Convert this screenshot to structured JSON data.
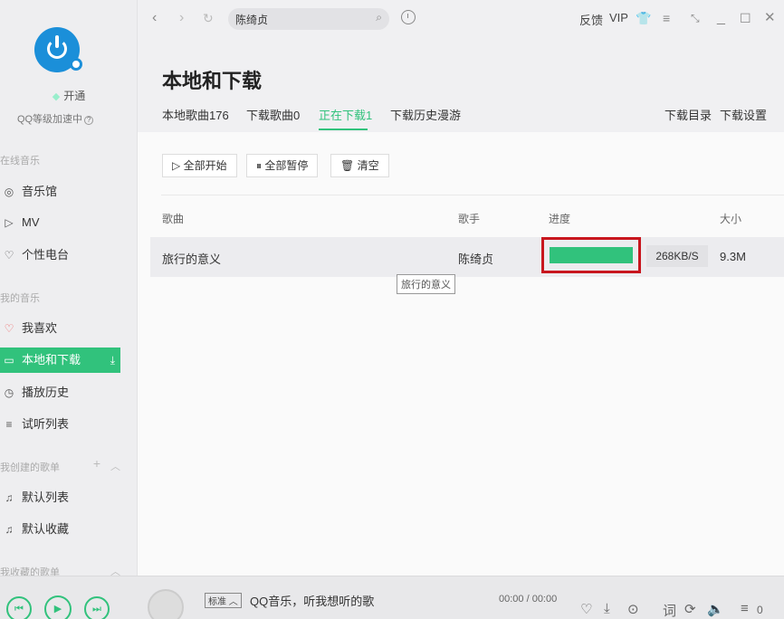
{
  "sidebar": {
    "vip_label": "开通",
    "level_text": "QQ等级加速中",
    "sections": {
      "online": "在线音乐",
      "my_music": "我的音乐",
      "created": "我创建的歌单",
      "collected": "我收藏的歌单"
    },
    "items": [
      {
        "label": "音乐馆",
        "icon": "◎"
      },
      {
        "label": "MV",
        "icon": "▷"
      },
      {
        "label": "个性电台",
        "icon": "♡"
      },
      {
        "label": "我喜欢",
        "icon": "♡"
      },
      {
        "label": "本地和下载",
        "icon": "▭"
      },
      {
        "label": "播放历史",
        "icon": "◷"
      },
      {
        "label": "试听列表",
        "icon": "≡"
      },
      {
        "label": "默认列表",
        "icon": "♫"
      },
      {
        "label": "默认收藏",
        "icon": "♫"
      }
    ]
  },
  "topbar": {
    "search_value": "陈绮贞",
    "feedback": "反馈",
    "vip": "VIP"
  },
  "page": {
    "title": "本地和下载",
    "tabs": [
      "本地歌曲176",
      "下载歌曲0",
      "正在下载1",
      "下载历史漫游"
    ],
    "download_dir": "下载目录",
    "download_settings": "下载设置"
  },
  "actions": {
    "start_all": "全部开始",
    "pause_all": "全部暂停",
    "clear": "清空"
  },
  "table": {
    "headers": {
      "song": "歌曲",
      "artist": "歌手",
      "progress": "进度",
      "size": "大小"
    },
    "rows": [
      {
        "song": "旅行的意义",
        "artist": "陈绮贞",
        "progress_pct": 100,
        "speed": "268KB/S",
        "size": "9.3M"
      }
    ],
    "tooltip": "旅行的意义"
  },
  "player": {
    "quality": "标准",
    "song": "QQ音乐，听我想听的歌",
    "time": "00:00 / 00:00",
    "playlist_count": "0"
  },
  "colors": {
    "accent": "#31c27c",
    "highlight_border": "#c8161e"
  }
}
